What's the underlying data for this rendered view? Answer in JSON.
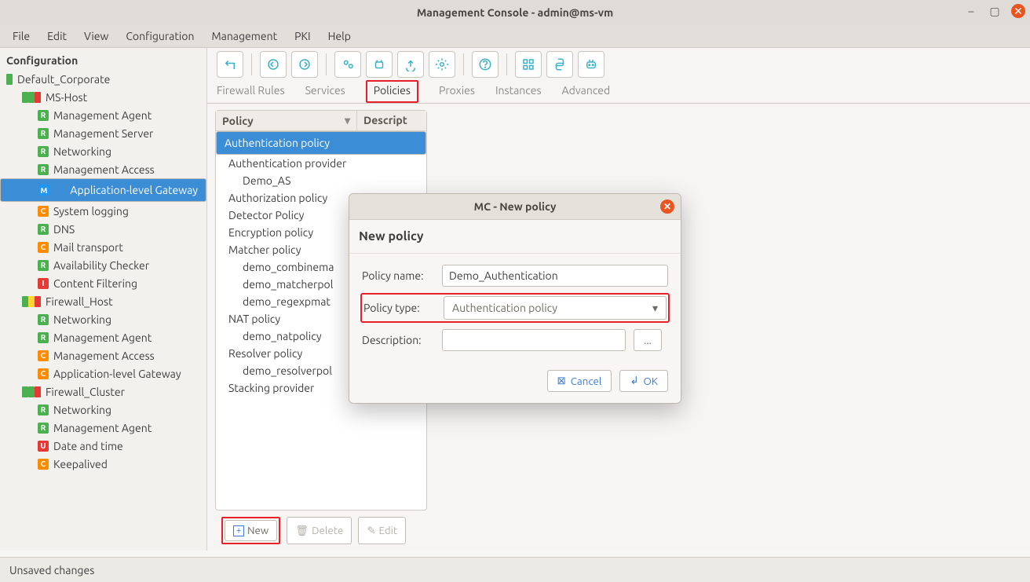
{
  "window": {
    "title": "Management Console - admin@ms-vm"
  },
  "menu": {
    "items": [
      "File",
      "Edit",
      "View",
      "Configuration",
      "Management",
      "PKI",
      "Help"
    ]
  },
  "sidebar": {
    "header": "Configuration",
    "tree": [
      {
        "indent": 0,
        "kind": "root",
        "label": "Default_Corporate",
        "chips": [
          "green"
        ]
      },
      {
        "indent": 1,
        "kind": "host",
        "label": "MS-Host",
        "chips": [
          "green",
          "green",
          "red"
        ]
      },
      {
        "indent": 2,
        "kind": "item",
        "label": "Management Agent",
        "chip": "R",
        "color": "green"
      },
      {
        "indent": 2,
        "kind": "item",
        "label": "Management Server",
        "chip": "R",
        "color": "green"
      },
      {
        "indent": 2,
        "kind": "item",
        "label": "Networking",
        "chip": "R",
        "color": "green"
      },
      {
        "indent": 2,
        "kind": "item",
        "label": "Management Access",
        "chip": "R",
        "color": "green"
      },
      {
        "indent": 2,
        "kind": "item",
        "label": "Application-level Gateway",
        "chip": "M",
        "color": "blue",
        "selected": true
      },
      {
        "indent": 2,
        "kind": "item",
        "label": "System logging",
        "chip": "C",
        "color": "orange"
      },
      {
        "indent": 2,
        "kind": "item",
        "label": "DNS",
        "chip": "R",
        "color": "green"
      },
      {
        "indent": 2,
        "kind": "item",
        "label": "Mail transport",
        "chip": "C",
        "color": "orange"
      },
      {
        "indent": 2,
        "kind": "item",
        "label": "Availability Checker",
        "chip": "R",
        "color": "green"
      },
      {
        "indent": 2,
        "kind": "item",
        "label": "Content Filtering",
        "chip": "I",
        "color": "red"
      },
      {
        "indent": 1,
        "kind": "host",
        "label": "Firewall_Host",
        "chips": [
          "green",
          "yellow",
          "red"
        ]
      },
      {
        "indent": 2,
        "kind": "item",
        "label": "Networking",
        "chip": "R",
        "color": "green"
      },
      {
        "indent": 2,
        "kind": "item",
        "label": "Management Agent",
        "chip": "R",
        "color": "green"
      },
      {
        "indent": 2,
        "kind": "item",
        "label": "Management Access",
        "chip": "C",
        "color": "orange"
      },
      {
        "indent": 2,
        "kind": "item",
        "label": "Application-level Gateway",
        "chip": "C",
        "color": "orange"
      },
      {
        "indent": 1,
        "kind": "host",
        "label": "Firewall_Cluster",
        "chips": [
          "green",
          "green",
          "red"
        ]
      },
      {
        "indent": 2,
        "kind": "item",
        "label": "Networking",
        "chip": "R",
        "color": "green"
      },
      {
        "indent": 2,
        "kind": "item",
        "label": "Management Agent",
        "chip": "R",
        "color": "green"
      },
      {
        "indent": 2,
        "kind": "item",
        "label": "Date and time",
        "chip": "U",
        "color": "red"
      },
      {
        "indent": 2,
        "kind": "item",
        "label": "Keepalived",
        "chip": "C",
        "color": "orange"
      }
    ]
  },
  "tabs": {
    "items": [
      "Firewall Rules",
      "Services",
      "Policies",
      "Proxies",
      "Instances",
      "Advanced"
    ],
    "active": 2
  },
  "list": {
    "columns": [
      "Policy",
      "Descript"
    ],
    "rows": [
      {
        "label": "Authentication policy",
        "sel": true
      },
      {
        "label": "Authentication provider"
      },
      {
        "label": "Demo_AS",
        "child": true
      },
      {
        "label": "Authorization policy"
      },
      {
        "label": "Detector Policy"
      },
      {
        "label": "Encryption policy"
      },
      {
        "label": "Matcher policy"
      },
      {
        "label": "demo_combinema",
        "child": true
      },
      {
        "label": "demo_matcherpol",
        "child": true
      },
      {
        "label": "demo_regexpmat",
        "child": true
      },
      {
        "label": "NAT policy"
      },
      {
        "label": "demo_natpolicy",
        "child": true
      },
      {
        "label": "Resolver policy"
      },
      {
        "label": "demo_resolverpol",
        "child": true
      },
      {
        "label": "Stacking provider"
      }
    ],
    "actions": {
      "new": "New",
      "delete": "Delete",
      "edit": "Edit"
    }
  },
  "dialog": {
    "title": "MC - New policy",
    "subtitle": "New policy",
    "name_label": "Policy name:",
    "name_value": "Demo_Authentication",
    "type_label": "Policy type:",
    "type_value": "Authentication policy",
    "desc_label": "Description:",
    "desc_value": "",
    "ellipsis": "...",
    "cancel": "Cancel",
    "ok": "OK"
  },
  "status": {
    "text": "Unsaved changes"
  }
}
